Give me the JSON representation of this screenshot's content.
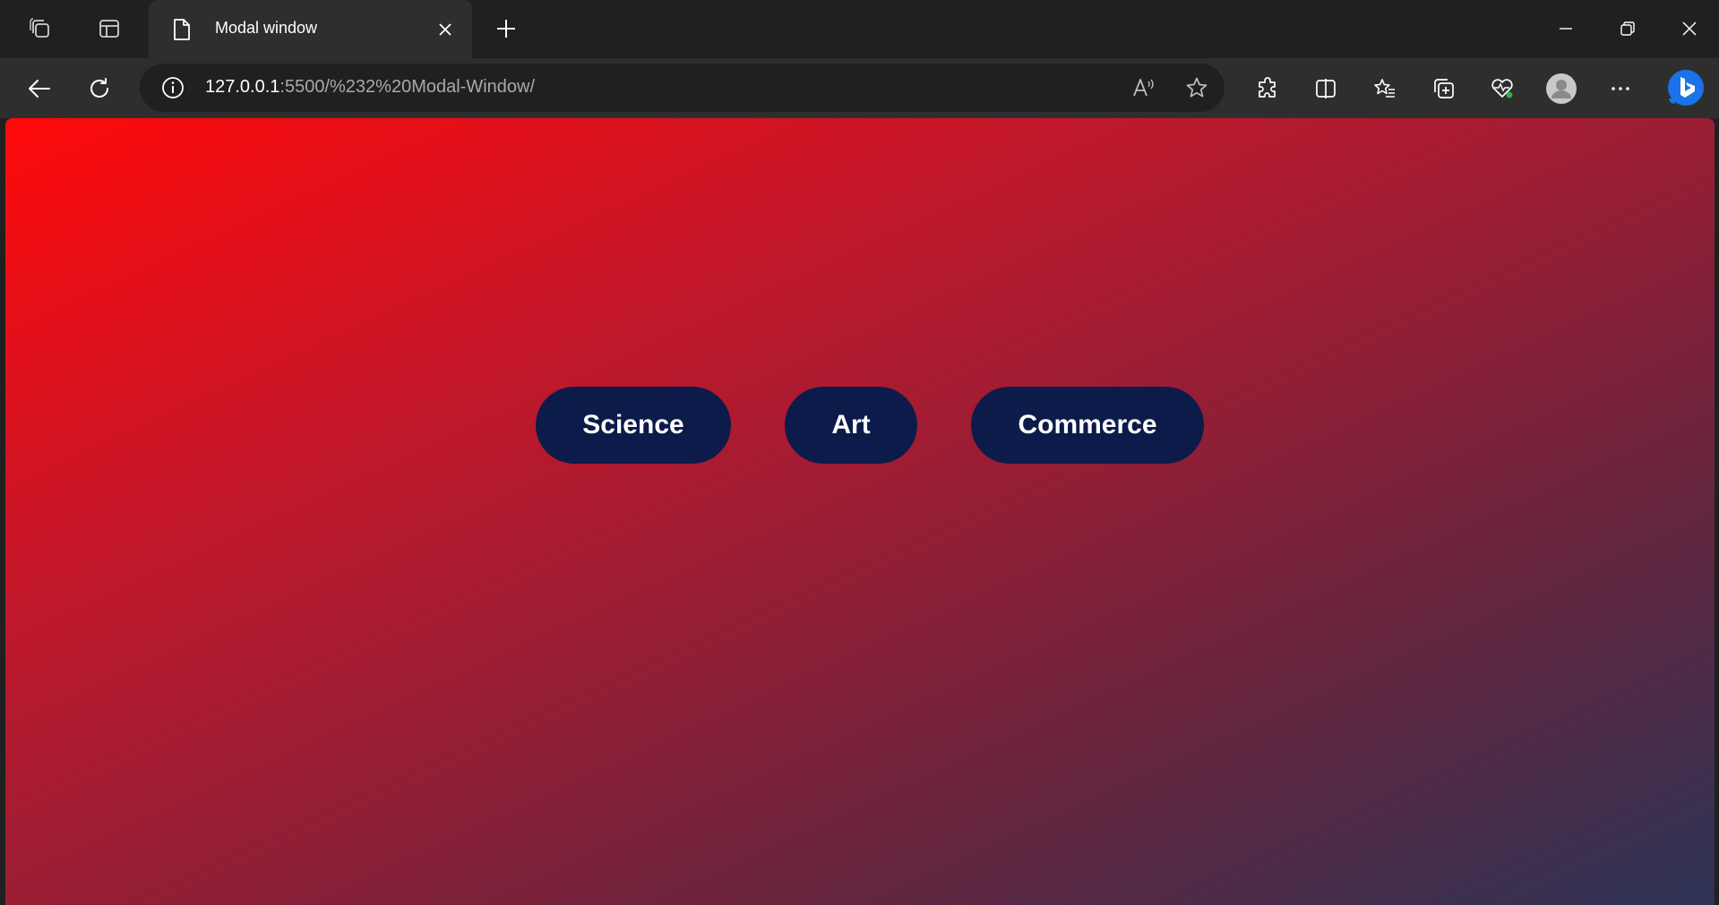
{
  "browser": {
    "tab": {
      "title": "Modal window",
      "icon": "page-icon",
      "close_icon": "close-icon"
    },
    "new_tab_icon": "plus-icon",
    "address": {
      "host": "127.0.0.1",
      "path": ":5500/%232%20Modal-Window/"
    },
    "window_controls": [
      "minimize-icon",
      "restore-icon",
      "close-icon"
    ]
  },
  "page": {
    "background_colors": [
      "#ff0a0a",
      "#c4172a",
      "#8f1f36",
      "#62263f",
      "#2c3355"
    ],
    "button_color": "#0d1b4a",
    "buttons": [
      {
        "label": "Science"
      },
      {
        "label": "Art"
      },
      {
        "label": "Commerce"
      }
    ]
  }
}
